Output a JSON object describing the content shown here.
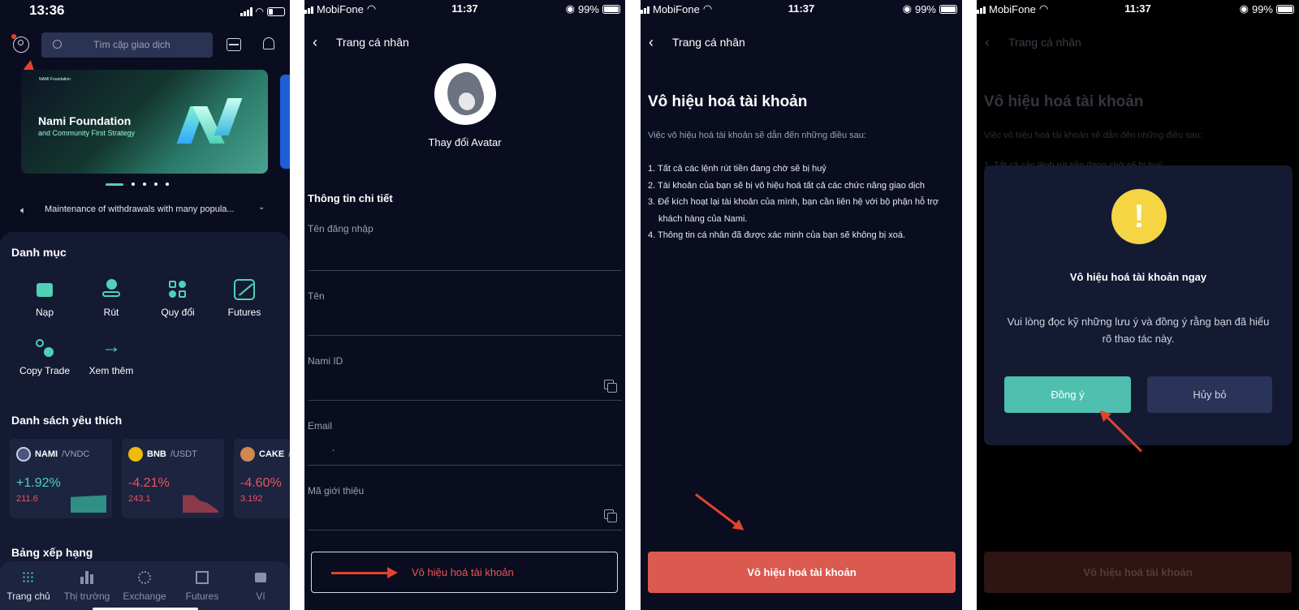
{
  "p1": {
    "time": "13:36",
    "search_placeholder": "Tìm cặp giao dịch",
    "banner": {
      "title": "Nami Foundation",
      "subtitle": "and Community First Strategy",
      "logo_text": "NAMI Foundation"
    },
    "announcement": "Maintenance of withdrawals with many popula...",
    "categories_title": "Danh mục",
    "categories": [
      "Nạp",
      "Rút",
      "Quy đổi",
      "Futures",
      "Copy Trade",
      "Xem thêm"
    ],
    "favorites_title": "Danh sách yêu thích",
    "favorites": [
      {
        "base": "NAMI",
        "quote": "/VNDC",
        "change": "+1.92%",
        "price": "211.6"
      },
      {
        "base": "BNB",
        "quote": "/USDT",
        "change": "-4.21%",
        "price": "243.1"
      },
      {
        "base": "CAKE",
        "quote": "/",
        "change": "-4.60%",
        "price": "3.192"
      }
    ],
    "ranking_title": "Bảng xếp hạng",
    "nav": [
      "Trang chủ",
      "Thị trường",
      "Exchange",
      "Futures",
      "Ví"
    ]
  },
  "status": {
    "carrier": "MobiFone",
    "time": "11:37",
    "battery": "99%"
  },
  "page_title": "Trang cá nhân",
  "p2": {
    "change_avatar": "Thay đổi Avatar",
    "section": "Thông tin chi tiết",
    "fields": [
      "Tên đăng nhập",
      "Tên",
      "Nami ID",
      "Email",
      "Mã giới thiệu"
    ],
    "email_value": "-",
    "deactivate": "Vô hiệu hoá tài khoản"
  },
  "p3": {
    "heading": "Vô hiệu hoá tài khoản",
    "intro": "Việc vô hiệu hoá tài khoản sẽ dẫn đến những điều sau:",
    "items": [
      "1. Tất cả các lệnh rút tiền đang chờ sẽ bị huỷ",
      "2. Tài khoản của bạn sẽ bị vô hiệu hoá tất cả các chức năng giao dịch",
      "3. Để kích hoạt lại tài khoản của mình, bạn cần liên hệ với bộ phận hỗ trợ",
      "khách hàng của Nami.",
      "4. Thông tin cá nhân đã được xác minh của bạn sẽ không bị xoá."
    ],
    "button": "Vô hiệu hoá tài khoản"
  },
  "p4": {
    "dialog_title": "Vô hiệu hoá tài khoản ngay",
    "dialog_msg_1": "Vui lòng đọc kỹ những lưu ý và đồng ý rằng bạn đã hiểu",
    "dialog_msg_2": "rõ thao tác này.",
    "agree": "Đồng ý",
    "cancel": "Hủy bỏ",
    "bg_line": "1. Tất cả các lệnh rút tiền đang chờ sẽ bị huỷ"
  },
  "colors": {
    "bg": "#0a0d1f",
    "teal": "#4fd1b6",
    "red": "#e8555a",
    "danger_btn": "#da5a50",
    "card": "#1c2440"
  }
}
